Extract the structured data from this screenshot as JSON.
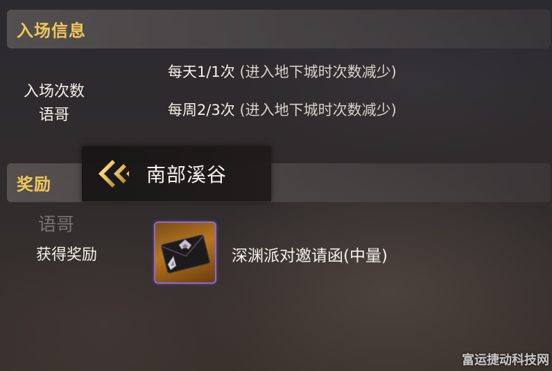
{
  "entry_section": {
    "title": "入场信息",
    "label": "入场次数",
    "watermark": "语哥",
    "daily_limit": "每天1/1次",
    "daily_note": " (进入地下城时次数减少)",
    "weekly_limit": "每周2/3次",
    "weekly_note": " (进入地下城时次数减少)"
  },
  "dungeon": {
    "name": "南部溪谷",
    "back_icon": "double-chevron-left-icon"
  },
  "reward_section": {
    "title": "奖励",
    "watermark": "语哥",
    "label": "获得奖励",
    "item_name": "深渊派对邀请函(中量)",
    "item_icon": "envelope-icon",
    "slot_border_color": "#8a6ad0"
  },
  "corner_watermark": "富运捷动科技网",
  "colors": {
    "section_title": "#f1c75a",
    "text": "#f4f1ea"
  }
}
